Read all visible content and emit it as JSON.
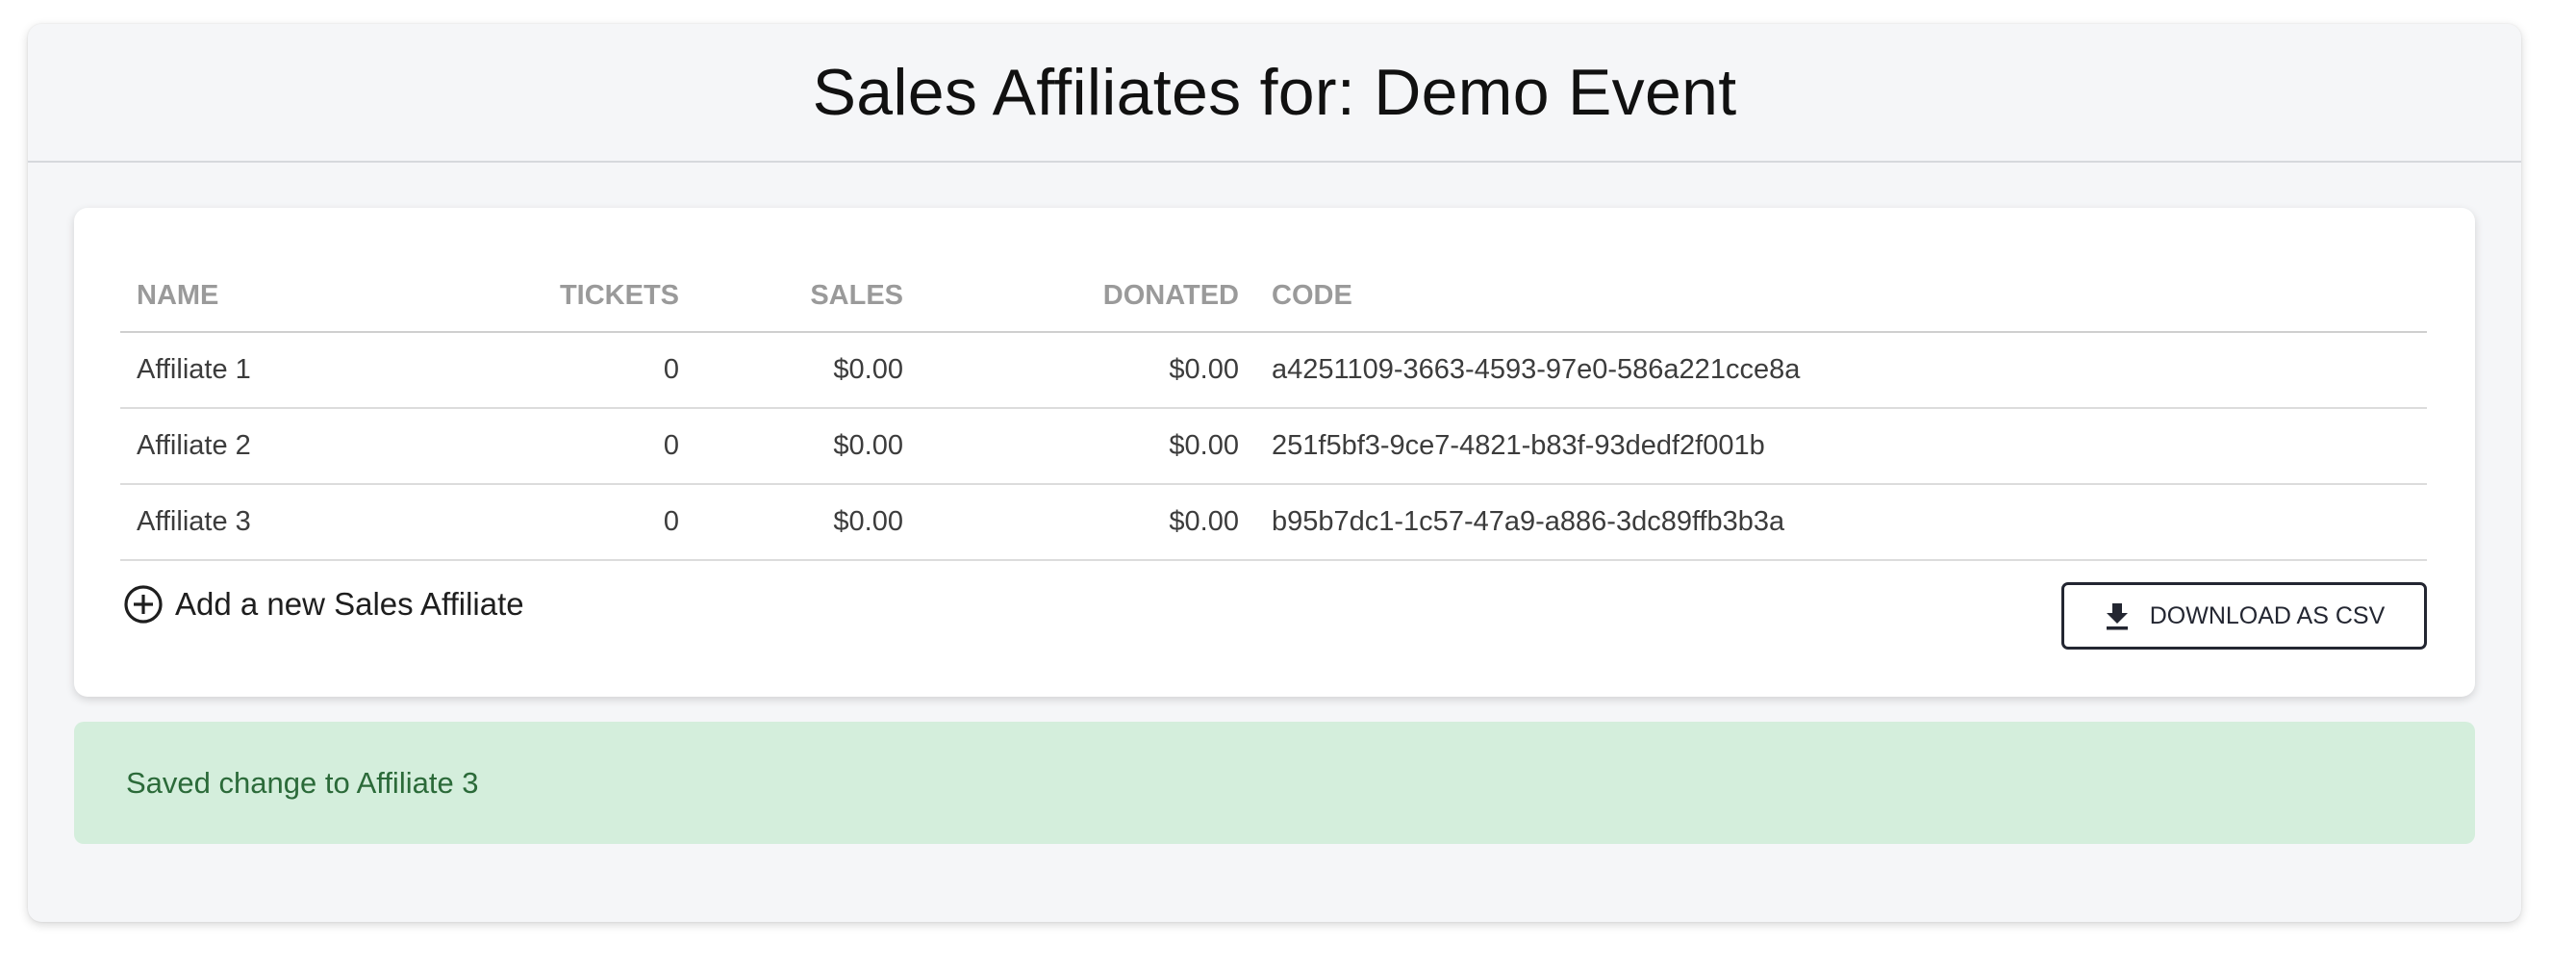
{
  "header": {
    "title": "Sales Affiliates for: Demo Event"
  },
  "table": {
    "columns": {
      "name": "NAME",
      "tickets": "TICKETS",
      "sales": "SALES",
      "donated": "DONATED",
      "code": "CODE"
    },
    "rows": [
      {
        "name": "Affiliate 1",
        "tickets": "0",
        "sales": "$0.00",
        "donated": "$0.00",
        "code": "a4251109-3663-4593-97e0-586a221cce8a"
      },
      {
        "name": "Affiliate 2",
        "tickets": "0",
        "sales": "$0.00",
        "donated": "$0.00",
        "code": "251f5bf3-9ce7-4821-b83f-93dedf2f001b"
      },
      {
        "name": "Affiliate 3",
        "tickets": "0",
        "sales": "$0.00",
        "donated": "$0.00",
        "code": "b95b7dc1-1c57-47a9-a886-3dc89ffb3b3a"
      }
    ]
  },
  "actions": {
    "add_label": "Add a new Sales Affiliate",
    "add_icon": "plus-circle-icon",
    "download_label": "DOWNLOAD AS CSV",
    "download_icon": "download-icon"
  },
  "alert": {
    "message": "Saved change to Affiliate 3",
    "status": "success"
  },
  "colors": {
    "success_bg": "#d4eedc",
    "success_text": "#2b6a39",
    "button_border": "#232631"
  }
}
